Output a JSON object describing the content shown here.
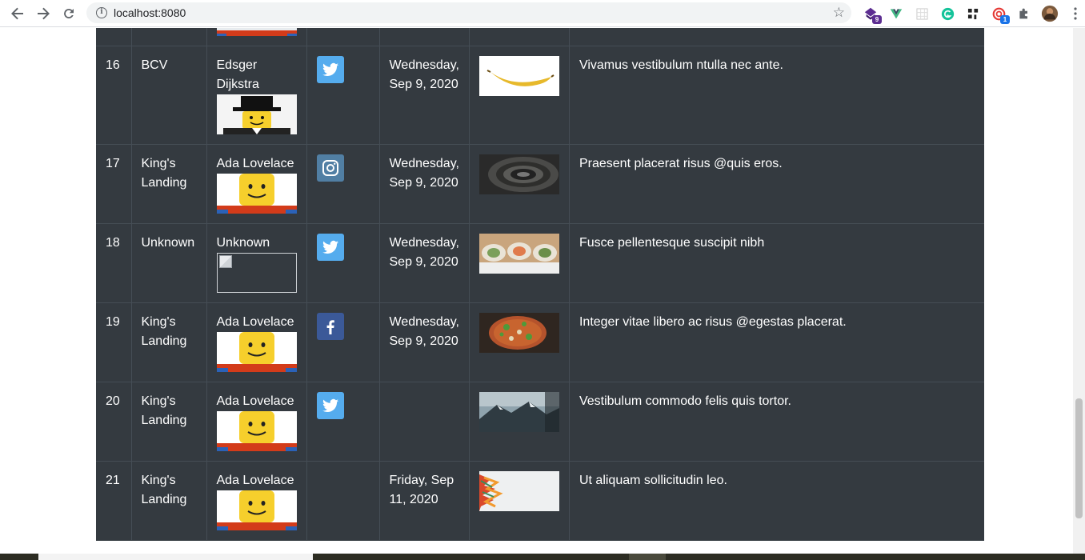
{
  "browser": {
    "url": "localhost:8080",
    "info_glyph": "i",
    "extensions": [
      {
        "name": "ext-purple",
        "badge": "9",
        "color": "#5c2d91"
      },
      {
        "name": "vue-devtools",
        "badge": "",
        "color": "#41b883"
      },
      {
        "name": "ext-grid",
        "badge": "",
        "color": "#c8c8c8"
      },
      {
        "name": "grammarly",
        "badge": "",
        "color": "#15c39a"
      },
      {
        "name": "ext-dark",
        "badge": "",
        "color": "#222222"
      },
      {
        "name": "ext-red",
        "badge": "1",
        "color": "#e53935"
      },
      {
        "name": "extensions",
        "badge": "",
        "color": "#5f6368"
      }
    ]
  },
  "table": {
    "rows": [
      {
        "id": "16",
        "house": "BCV",
        "person": "Edsger Dijkstra",
        "avatar": "lego-hat-icon",
        "social": "twitter",
        "date": "Wednesday, Sep 9, 2020",
        "image": "banana",
        "text": "Vivamus vestibulum ntulla nec ante."
      },
      {
        "id": "17",
        "house": "King's Landing",
        "person": "Ada Lovelace",
        "avatar": "lego-face-icon",
        "social": "instagram",
        "date": "Wednesday, Sep 9, 2020",
        "image": "spiral",
        "text": "Praesent placerat risus @quis eros."
      },
      {
        "id": "18",
        "house": "Unknown",
        "person": "Unknown",
        "avatar": "broken-image-icon",
        "social": "twitter",
        "date": "Wednesday, Sep 9, 2020",
        "image": "sushi",
        "text": "Fusce pellentesque suscipit nibh"
      },
      {
        "id": "19",
        "house": "King's Landing",
        "person": "Ada Lovelace",
        "avatar": "lego-face-icon",
        "social": "facebook",
        "date": "Wednesday, Sep 9, 2020",
        "image": "pizza",
        "text": "Integer vitae libero ac risus @egestas placerat."
      },
      {
        "id": "20",
        "house": "King's Landing",
        "person": "Ada Lovelace",
        "avatar": "lego-face-icon",
        "social": "twitter",
        "date": "",
        "image": "mountain",
        "text": "Vestibulum commodo felis quis tortor."
      },
      {
        "id": "21",
        "house": "King's Landing",
        "person": "Ada Lovelace",
        "avatar": "lego-face-icon",
        "social": "",
        "date": "Friday, Sep 11, 2020",
        "image": "splash",
        "text": "Ut aliquam sollicitudin leo."
      }
    ]
  },
  "colors": {
    "table_bg": "#343a40",
    "border": "#454d55",
    "twitter": "#55acee",
    "instagram": "#517fa4",
    "facebook": "#3b5998"
  }
}
